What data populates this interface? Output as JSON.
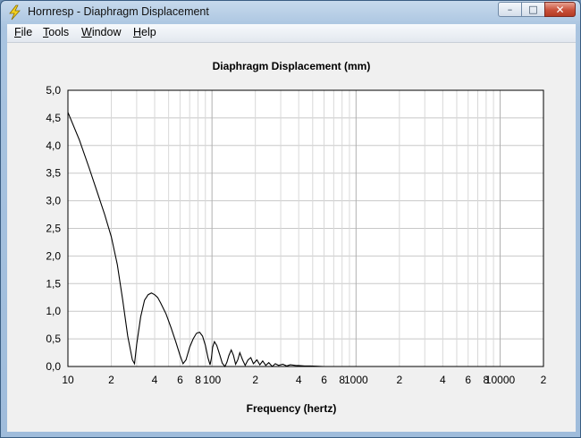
{
  "window": {
    "title": "Hornresp - Diaphragm Displacement",
    "controls": {
      "minimize": "–",
      "maximize": "□",
      "close": "✕"
    }
  },
  "menu": [
    {
      "accel": "F",
      "rest": "ile"
    },
    {
      "accel": "T",
      "rest": "ools"
    },
    {
      "accel": "W",
      "rest": "indow"
    },
    {
      "accel": "H",
      "rest": "elp"
    }
  ],
  "chart_data": {
    "type": "line",
    "title": "Diaphragm Displacement (mm)",
    "xlabel": "Frequency (hertz)",
    "ylabel": "",
    "x_scale": "log",
    "xlim": [
      10,
      20000
    ],
    "ylim": [
      0,
      5
    ],
    "grid": true,
    "yticks": [
      "0,0",
      "0,5",
      "1,0",
      "1,5",
      "2,0",
      "2,5",
      "3,0",
      "3,5",
      "4,0",
      "4,5",
      "5,0"
    ],
    "xticks": [
      {
        "value": 10,
        "label": "10"
      },
      {
        "value": 20,
        "label": "2"
      },
      {
        "value": 40,
        "label": "4"
      },
      {
        "value": 60,
        "label": "6"
      },
      {
        "value": 80,
        "label": "8"
      },
      {
        "value": 100,
        "label": "100"
      },
      {
        "value": 200,
        "label": "2"
      },
      {
        "value": 400,
        "label": "4"
      },
      {
        "value": 600,
        "label": "6"
      },
      {
        "value": 800,
        "label": "8"
      },
      {
        "value": 1000,
        "label": "1000"
      },
      {
        "value": 2000,
        "label": "2"
      },
      {
        "value": 4000,
        "label": "4"
      },
      {
        "value": 6000,
        "label": "6"
      },
      {
        "value": 8000,
        "label": "8"
      },
      {
        "value": 10000,
        "label": "10000"
      },
      {
        "value": 20000,
        "label": "2"
      }
    ],
    "series": [
      {
        "color": "#000000",
        "x": [
          10,
          12,
          14,
          16,
          18,
          20,
          22,
          24,
          26,
          28,
          29,
          30,
          32,
          34,
          36,
          38,
          40,
          42,
          44,
          48,
          52,
          56,
          60,
          63,
          66,
          70,
          74,
          78,
          82,
          86,
          90,
          94,
          97,
          99,
          101,
          104,
          108,
          113,
          118,
          123,
          127,
          131,
          136,
          141,
          146,
          151,
          156,
          163,
          170,
          178,
          186,
          194,
          205,
          215,
          225,
          236,
          248,
          262,
          275,
          290,
          310,
          330,
          350,
          380,
          410,
          440,
          480,
          530,
          600,
          700
        ],
        "y": [
          4.6,
          4.1,
          3.6,
          3.15,
          2.75,
          2.35,
          1.85,
          1.2,
          0.55,
          0.12,
          0.05,
          0.4,
          0.9,
          1.2,
          1.3,
          1.33,
          1.3,
          1.25,
          1.15,
          0.95,
          0.7,
          0.45,
          0.2,
          0.05,
          0.12,
          0.35,
          0.5,
          0.6,
          0.62,
          0.55,
          0.38,
          0.15,
          0.03,
          0.15,
          0.35,
          0.45,
          0.38,
          0.22,
          0.06,
          0.0,
          0.08,
          0.2,
          0.3,
          0.2,
          0.04,
          0.12,
          0.25,
          0.12,
          0.02,
          0.12,
          0.16,
          0.05,
          0.12,
          0.03,
          0.1,
          0.02,
          0.07,
          0.0,
          0.05,
          0.02,
          0.04,
          0.01,
          0.03,
          0.02,
          0.015,
          0.01,
          0.01,
          0.005,
          0.0,
          0.0
        ]
      }
    ]
  }
}
